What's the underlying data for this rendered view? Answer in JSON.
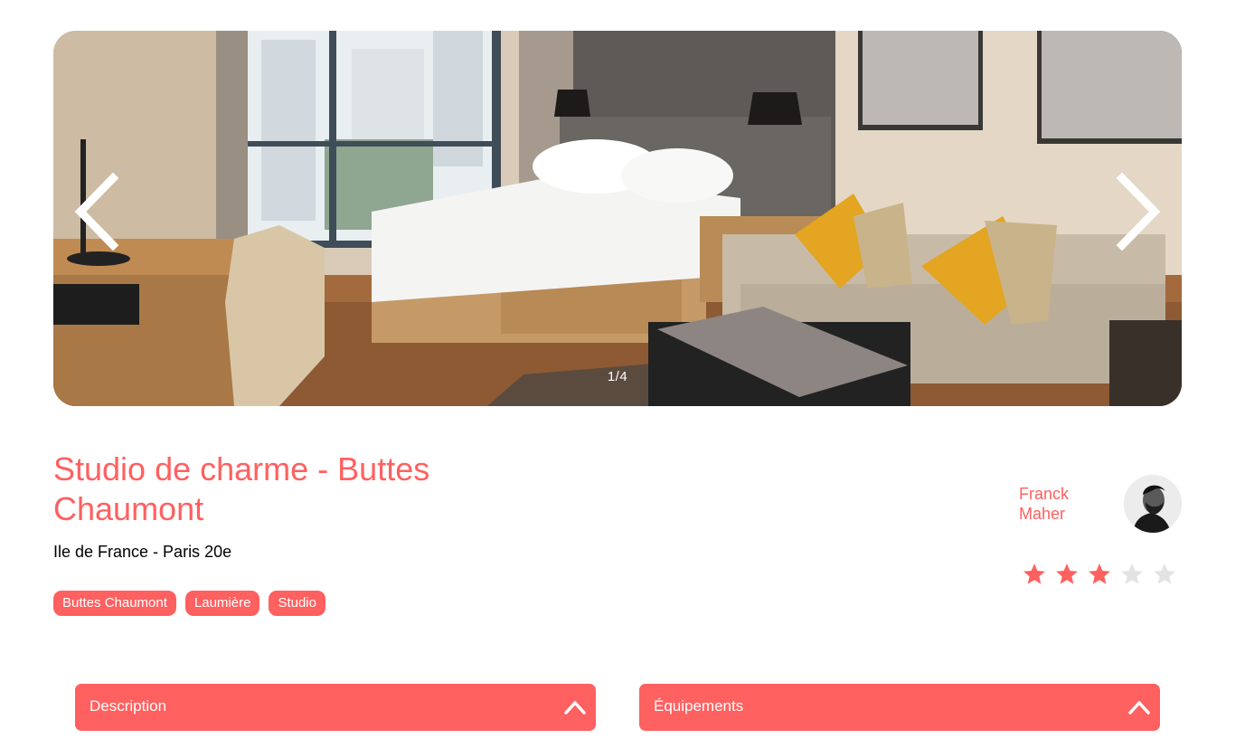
{
  "carousel": {
    "counter": "1/4",
    "prev_icon": "chevron-left-icon",
    "next_icon": "chevron-right-icon",
    "current_index": 1,
    "total": 4
  },
  "listing": {
    "title": "Studio de charme - Buttes Chaumont",
    "location": "Ile de France - Paris 20e",
    "tags": [
      "Buttes Chaumont",
      "Laumière",
      "Studio"
    ]
  },
  "host": {
    "first_name": "Franck",
    "last_name": "Maher"
  },
  "rating": {
    "value": 3,
    "max": 5
  },
  "collapses": {
    "description": "Description",
    "equipments": "Équipements",
    "chevron_icon": "chevron-up-icon"
  },
  "colors": {
    "accent": "#ff6060",
    "star_empty": "#e3e3e3",
    "text": "#000000",
    "on_accent": "#ffffff"
  }
}
